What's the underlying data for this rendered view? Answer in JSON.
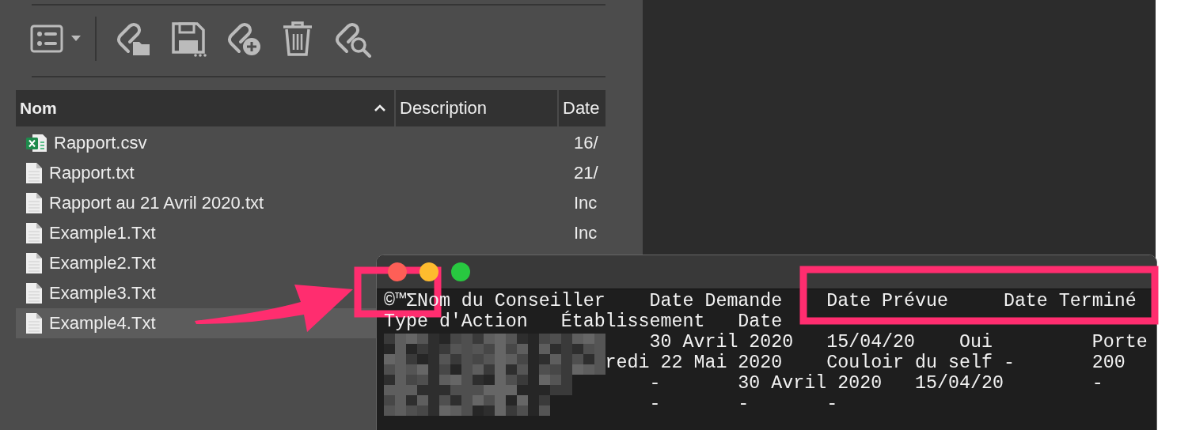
{
  "toolbar": {
    "items": [
      {
        "kind": "view"
      },
      {
        "kind": "attach-folder"
      },
      {
        "kind": "save"
      },
      {
        "kind": "attach-add"
      },
      {
        "kind": "delete"
      },
      {
        "kind": "attach-search"
      }
    ]
  },
  "table": {
    "columns": [
      {
        "label": "Nom",
        "sorted": true
      },
      {
        "label": "Description",
        "sorted": false
      },
      {
        "label": "Date",
        "sorted": false
      }
    ],
    "rows": [
      {
        "name": "Rapport.csv",
        "kind": "csv",
        "date": "16/",
        "selected": false
      },
      {
        "name": "Rapport.txt",
        "kind": "txt",
        "date": "21/",
        "selected": false
      },
      {
        "name": "Rapport au 21 Avril 2020.txt",
        "kind": "txt",
        "date": "Inc",
        "selected": false
      },
      {
        "name": "Example1.Txt",
        "kind": "txt",
        "date": "Inc",
        "selected": false
      },
      {
        "name": "Example2.Txt",
        "kind": "txt",
        "selected": false
      },
      {
        "name": "Example3.Txt",
        "kind": "txt",
        "selected": false
      },
      {
        "name": "Example4.Txt",
        "kind": "txt",
        "selected": true
      }
    ]
  },
  "terminal": {
    "lines": [
      "©™ΣNom du Conseiller    Date Demande    Date Prévue     Date Terminé",
      "Type d'Action   Établissement   Date",
      "                        30 Avril 2020   15/04/20    Oui         Porte",
      "                    redi 22 Mai 2020    Couloir du self -       200",
      "                        -       30 Avril 2020   15/04/20        -",
      "                        -       -       -"
    ]
  }
}
